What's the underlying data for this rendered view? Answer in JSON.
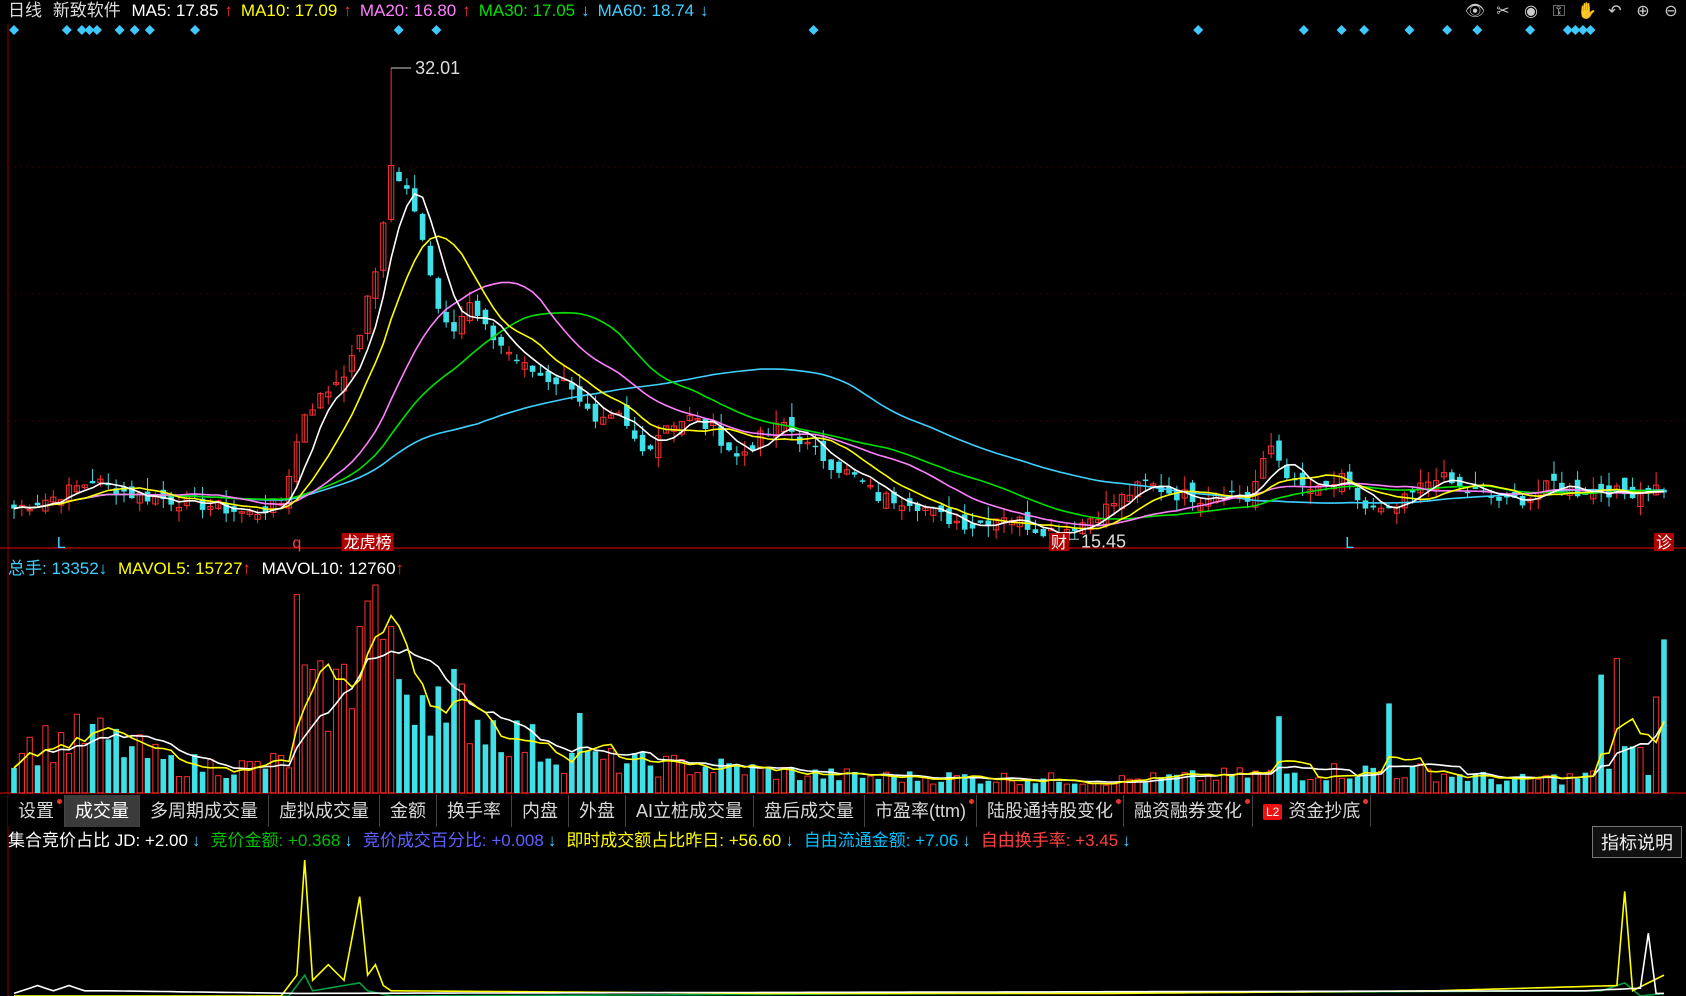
{
  "header": {
    "period": "日线",
    "stock_name": "新致软件",
    "ma": [
      {
        "label": "MA5: 17.85",
        "arrow": "↑",
        "color": "#ffffff"
      },
      {
        "label": "MA10: 17.09",
        "arrow": "↑",
        "color": "#ffff00"
      },
      {
        "label": "MA20: 16.80",
        "arrow": "↑",
        "color": "#ff80ff"
      },
      {
        "label": "MA30: 17.05",
        "arrow": "↓",
        "color": "#00e000"
      },
      {
        "label": "MA60: 18.74",
        "arrow": "↓",
        "color": "#40d0ff"
      }
    ]
  },
  "toolbar": [
    "eye-icon",
    "scissors-icon",
    "play-icon",
    "lock-icon",
    "hand-icon",
    "undo-icon",
    "zoom-in-icon",
    "zoom-out-icon"
  ],
  "price_panel": {
    "high_label": "32.01",
    "low_label": "15.45",
    "markers": [
      {
        "text": "L",
        "idx": 6,
        "color": "#40d0ff",
        "box": false
      },
      {
        "text": "q",
        "idx": 36,
        "color": "#ff4040",
        "box": false
      },
      {
        "text": "龙虎榜",
        "idx": 45,
        "color": "#ffffff",
        "box": true
      },
      {
        "text": "财",
        "idx": 133,
        "color": "#ffffff",
        "box": true
      },
      {
        "text": "L",
        "idx": 170,
        "color": "#40d0ff",
        "box": false
      },
      {
        "text": "诊",
        "idx": 210,
        "color": "#ffffff",
        "box": true
      }
    ]
  },
  "volume_panel": {
    "total_label": "总手: 13352",
    "total_arrow": "↓",
    "mavol5_label": "MAVOL5: 15727",
    "mavol5_arrow": "↑",
    "mavol10_label": "MAVOL10: 12760",
    "mavol10_arrow": "↑"
  },
  "tabs": [
    {
      "label": "设置",
      "dot": true,
      "l2": false,
      "active": false
    },
    {
      "label": "成交量",
      "dot": false,
      "l2": false,
      "active": true
    },
    {
      "label": "多周期成交量",
      "dot": false,
      "l2": false,
      "active": false
    },
    {
      "label": "虚拟成交量",
      "dot": false,
      "l2": false,
      "active": false
    },
    {
      "label": "金额",
      "dot": false,
      "l2": false,
      "active": false
    },
    {
      "label": "换手率",
      "dot": false,
      "l2": false,
      "active": false
    },
    {
      "label": "内盘",
      "dot": false,
      "l2": false,
      "active": false
    },
    {
      "label": "外盘",
      "dot": false,
      "l2": false,
      "active": false
    },
    {
      "label": "AI立桩成交量",
      "dot": false,
      "l2": false,
      "active": false
    },
    {
      "label": "盘后成交量",
      "dot": false,
      "l2": false,
      "active": false
    },
    {
      "label": "市盈率(ttm)",
      "dot": true,
      "l2": false,
      "active": false
    },
    {
      "label": "陆股通持股变化",
      "dot": true,
      "l2": false,
      "active": false
    },
    {
      "label": "融资融券变化",
      "dot": true,
      "l2": false,
      "active": false
    },
    {
      "label": "资金抄底",
      "dot": true,
      "l2": true,
      "active": false
    }
  ],
  "indicator_panel": {
    "items": [
      {
        "label": "集合竞价占比 JD: ",
        "value": "+2.00",
        "arrow": "↓",
        "color": "#ffffff"
      },
      {
        "label": "竞价金额: ",
        "value": "+0.368",
        "arrow": "↓",
        "color": "#00c000"
      },
      {
        "label": "竞价成交百分比: ",
        "value": "+0.008",
        "arrow": "↓",
        "color": "#6060ff"
      },
      {
        "label": "即时成交额占比昨日: ",
        "value": "+56.60",
        "arrow": "↓",
        "color": "#ffff00"
      },
      {
        "label": "自由流通金额: ",
        "value": "+7.06",
        "arrow": "↓",
        "color": "#00c0ff"
      },
      {
        "label": "自由换手率: ",
        "value": "+3.45",
        "arrow": "↓",
        "color": "#ff4040"
      }
    ],
    "button_label": "指标说明"
  },
  "colors": {
    "up": "#ff3030",
    "down": "#40e0e8",
    "grid": "#8a0000",
    "ma5": "#ffffff",
    "ma10": "#ffff00",
    "ma20": "#ff80ff",
    "ma30": "#00e000",
    "ma60": "#40d0ff"
  },
  "chart_data": {
    "type": "candlestick",
    "y_range": [
      15.0,
      33.0
    ],
    "volume_range": [
      0,
      65000
    ],
    "anchor_closes": [
      [
        0,
        16.4
      ],
      [
        5,
        16.8
      ],
      [
        10,
        17.4
      ],
      [
        15,
        16.9
      ],
      [
        20,
        16.7
      ],
      [
        25,
        16.5
      ],
      [
        30,
        16.2
      ],
      [
        34,
        16.6
      ],
      [
        37,
        19.8
      ],
      [
        40,
        20.6
      ],
      [
        43,
        21.6
      ],
      [
        46,
        24.8
      ],
      [
        48,
        28.5
      ],
      [
        50,
        27.6
      ],
      [
        52,
        26.1
      ],
      [
        54,
        23.5
      ],
      [
        56,
        22.9
      ],
      [
        58,
        23.6
      ],
      [
        60,
        22.7
      ],
      [
        62,
        22.2
      ],
      [
        65,
        21.4
      ],
      [
        68,
        21.0
      ],
      [
        71,
        20.8
      ],
      [
        74,
        19.3
      ],
      [
        77,
        19.6
      ],
      [
        80,
        18.4
      ],
      [
        83,
        19.4
      ],
      [
        86,
        19.6
      ],
      [
        89,
        19.2
      ],
      [
        92,
        18.2
      ],
      [
        95,
        18.9
      ],
      [
        98,
        19.4
      ],
      [
        101,
        18.6
      ],
      [
        104,
        18.0
      ],
      [
        107,
        17.5
      ],
      [
        110,
        16.8
      ],
      [
        114,
        16.7
      ],
      [
        118,
        16.1
      ],
      [
        122,
        15.8
      ],
      [
        126,
        16.2
      ],
      [
        130,
        15.7
      ],
      [
        133,
        15.6
      ],
      [
        136,
        15.9
      ],
      [
        140,
        16.6
      ],
      [
        144,
        17.3
      ],
      [
        148,
        16.9
      ],
      [
        151,
        16.8
      ],
      [
        154,
        17.1
      ],
      [
        157,
        16.7
      ],
      [
        160,
        18.6
      ],
      [
        163,
        17.2
      ],
      [
        166,
        17.0
      ],
      [
        169,
        17.4
      ],
      [
        172,
        16.4
      ],
      [
        175,
        16.2
      ],
      [
        178,
        16.9
      ],
      [
        181,
        17.6
      ],
      [
        184,
        17.1
      ],
      [
        187,
        16.9
      ],
      [
        190,
        16.6
      ],
      [
        193,
        16.8
      ],
      [
        196,
        17.3
      ],
      [
        199,
        17.0
      ],
      [
        202,
        17.1
      ],
      [
        205,
        16.9
      ],
      [
        208,
        17.2
      ],
      [
        210,
        17.1
      ]
    ],
    "volume_spikes": [
      [
        36,
        62000
      ],
      [
        37,
        40000
      ],
      [
        44,
        52000
      ],
      [
        45,
        60000
      ],
      [
        46,
        65000
      ],
      [
        47,
        48000
      ],
      [
        55,
        22000
      ],
      [
        72,
        25000
      ],
      [
        161,
        24000
      ],
      [
        175,
        28000
      ],
      [
        202,
        37000
      ],
      [
        204,
        42000
      ],
      [
        209,
        30000
      ],
      [
        210,
        48000
      ]
    ],
    "anchor_volumes": [
      [
        0,
        14000
      ],
      [
        10,
        18000
      ],
      [
        20,
        9000
      ],
      [
        30,
        8000
      ],
      [
        35,
        10000
      ],
      [
        38,
        28000
      ],
      [
        42,
        33000
      ],
      [
        46,
        42000
      ],
      [
        50,
        35000
      ],
      [
        55,
        30000
      ],
      [
        60,
        22000
      ],
      [
        70,
        11000
      ],
      [
        80,
        9000
      ],
      [
        90,
        8000
      ],
      [
        100,
        6000
      ],
      [
        110,
        5000
      ],
      [
        120,
        5000
      ],
      [
        130,
        4500
      ],
      [
        140,
        4000
      ],
      [
        150,
        5000
      ],
      [
        160,
        6000
      ],
      [
        170,
        7000
      ],
      [
        180,
        6500
      ],
      [
        190,
        4000
      ],
      [
        200,
        5000
      ],
      [
        205,
        13000
      ],
      [
        208,
        9000
      ],
      [
        210,
        14000
      ]
    ],
    "auction_series": {
      "yellow_anchors": [
        [
          0,
          0.0
        ],
        [
          34,
          0.0
        ],
        [
          36,
          0.4
        ],
        [
          37,
          2.6
        ],
        [
          38,
          0.3
        ],
        [
          40,
          0.6
        ],
        [
          42,
          0.3
        ],
        [
          44,
          1.9
        ],
        [
          45,
          0.4
        ],
        [
          46,
          0.6
        ],
        [
          47,
          0.2
        ],
        [
          48,
          0.1
        ],
        [
          95,
          0.05
        ],
        [
          140,
          0.05
        ],
        [
          181,
          0.1
        ],
        [
          204,
          0.2
        ],
        [
          205,
          2.0
        ],
        [
          206,
          0.1
        ],
        [
          210,
          0.4
        ]
      ],
      "green_anchors": [
        [
          0,
          0.0
        ],
        [
          35,
          0.0
        ],
        [
          37,
          0.4
        ],
        [
          38,
          0.1
        ],
        [
          44,
          0.25
        ],
        [
          45,
          0.1
        ],
        [
          48,
          0.0
        ],
        [
          202,
          0.1
        ],
        [
          205,
          0.25
        ],
        [
          207,
          0.0
        ],
        [
          210,
          0.05
        ]
      ],
      "white_anchors": [
        [
          0,
          0.05
        ],
        [
          3,
          0.2
        ],
        [
          5,
          0.1
        ],
        [
          7,
          0.2
        ],
        [
          9,
          0.1
        ],
        [
          12,
          0.1
        ],
        [
          36,
          0.05
        ],
        [
          200,
          0.1
        ],
        [
          207,
          0.15
        ],
        [
          208,
          1.2
        ],
        [
          209,
          0.05
        ]
      ]
    }
  }
}
